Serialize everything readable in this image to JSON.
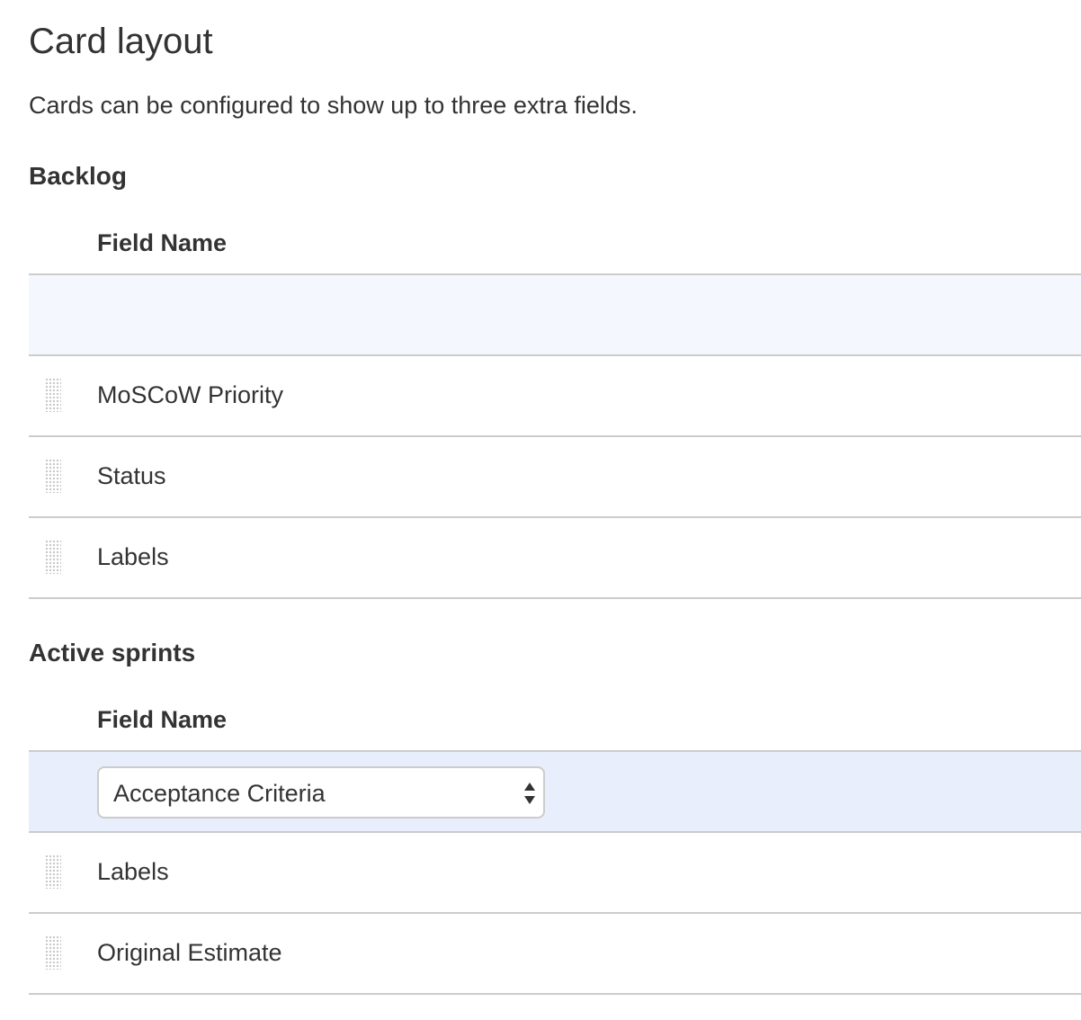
{
  "page": {
    "title": "Card layout",
    "description": "Cards can be configured to show up to three extra fields."
  },
  "backlog": {
    "heading": "Backlog",
    "column_header": "Field Name",
    "fields": [
      "MoSCoW Priority",
      "Status",
      "Labels"
    ]
  },
  "active_sprints": {
    "heading": "Active sprints",
    "column_header": "Field Name",
    "select_value": "Acceptance Criteria",
    "fields": [
      "Labels",
      "Original Estimate"
    ]
  },
  "icons": {
    "drag_handle": "drag-handle-icon",
    "select_arrows": "select-arrows-icon"
  },
  "colors": {
    "text": "#333333",
    "border": "#cccccc",
    "empty_add_row_bg": "#f4f7fe",
    "select_add_row_bg": "#e8eefc"
  }
}
